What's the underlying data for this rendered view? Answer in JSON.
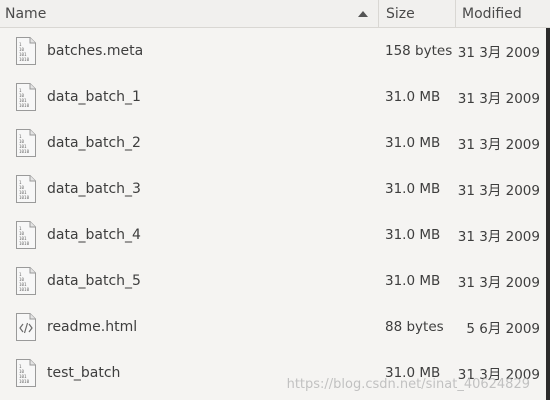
{
  "columns": {
    "name": "Name",
    "size": "Size",
    "modified": "Modified"
  },
  "files": [
    {
      "name": "batches.meta",
      "size": "158 bytes",
      "modified": "31 3月 2009",
      "icon": "binary-file-icon"
    },
    {
      "name": "data_batch_1",
      "size": "31.0 MB",
      "modified": "31 3月 2009",
      "icon": "binary-file-icon"
    },
    {
      "name": "data_batch_2",
      "size": "31.0 MB",
      "modified": "31 3月 2009",
      "icon": "binary-file-icon"
    },
    {
      "name": "data_batch_3",
      "size": "31.0 MB",
      "modified": "31 3月 2009",
      "icon": "binary-file-icon"
    },
    {
      "name": "data_batch_4",
      "size": "31.0 MB",
      "modified": "31 3月 2009",
      "icon": "binary-file-icon"
    },
    {
      "name": "data_batch_5",
      "size": "31.0 MB",
      "modified": "31 3月 2009",
      "icon": "binary-file-icon"
    },
    {
      "name": "readme.html",
      "size": "88 bytes",
      "modified": "5 6月 2009",
      "icon": "html-file-icon"
    },
    {
      "name": "test_batch",
      "size": "31.0 MB",
      "modified": "31 3月 2009",
      "icon": "binary-file-icon"
    }
  ],
  "watermark": "https://blog.csdn.net/sinat_40624829"
}
